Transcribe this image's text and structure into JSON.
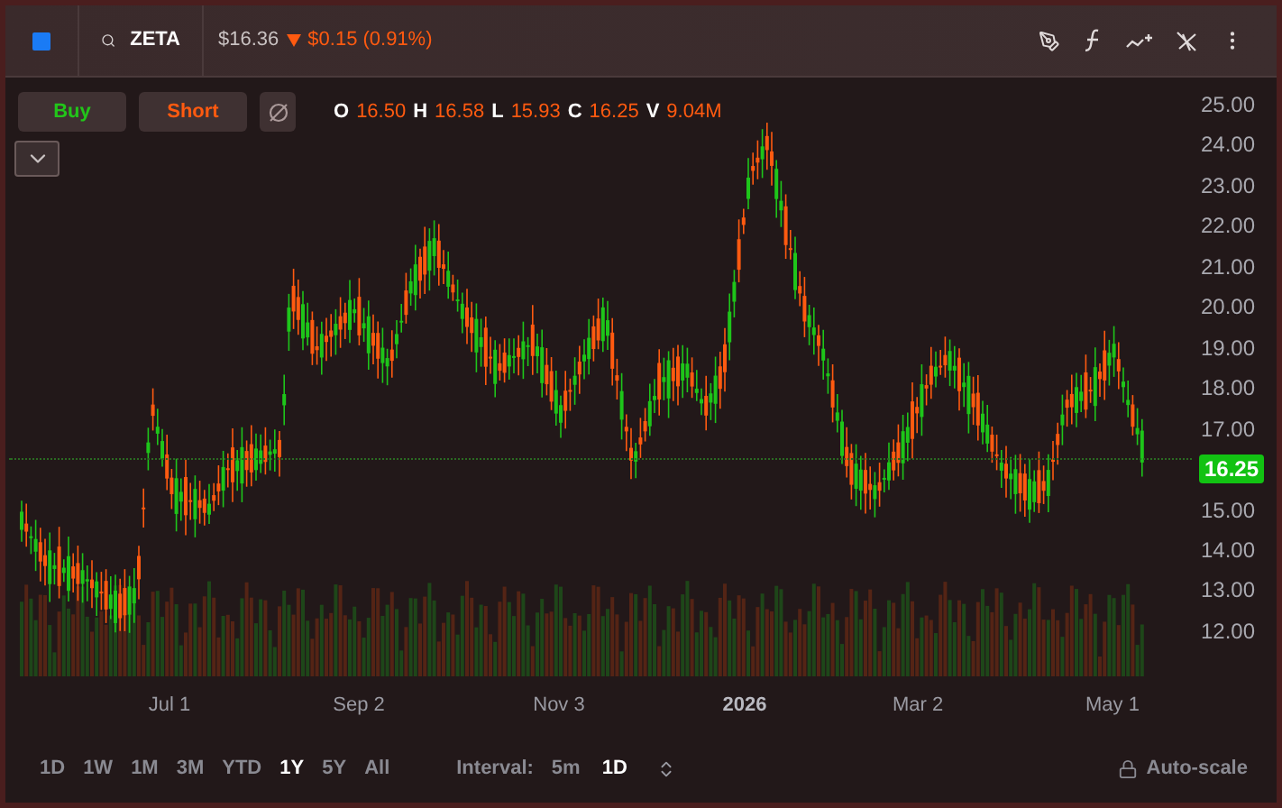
{
  "header": {
    "symbol": "ZETA",
    "price": "$16.36",
    "down": true,
    "change": "$0.15 (0.91%)"
  },
  "actions": [
    {
      "label": "Buy",
      "kind": "buy"
    },
    {
      "label": "Short",
      "kind": "short"
    }
  ],
  "ohlcv": [
    {
      "key": "O",
      "value": "16.50"
    },
    {
      "key": "H",
      "value": "16.58"
    },
    {
      "key": "L",
      "value": "15.93"
    },
    {
      "key": "C",
      "value": "16.25"
    },
    {
      "key": "V",
      "value": "9.04M"
    }
  ],
  "y_axis": [
    {
      "label": "25.00",
      "kind": "tick"
    },
    {
      "label": "24.00",
      "kind": "tick"
    },
    {
      "label": "23.00",
      "kind": "tick"
    },
    {
      "label": "22.00",
      "kind": "tick"
    },
    {
      "label": "21.00",
      "kind": "tick"
    },
    {
      "label": "20.00",
      "kind": "tick"
    },
    {
      "label": "19.00",
      "kind": "tick"
    },
    {
      "label": "18.00",
      "kind": "tick"
    },
    {
      "label": "17.00",
      "kind": "tick"
    },
    {
      "label": "16.25",
      "kind": "current"
    },
    {
      "label": "15.00",
      "kind": "tick"
    },
    {
      "label": "14.00",
      "kind": "tick"
    },
    {
      "label": "13.00",
      "kind": "tick"
    },
    {
      "label": "12.00",
      "kind": "tick"
    }
  ],
  "x_axis": [
    {
      "label": "Jul 1",
      "bold": false
    },
    {
      "label": "Sep 2",
      "bold": false
    },
    {
      "label": "Nov 3",
      "bold": false
    },
    {
      "label": "2026",
      "bold": true
    },
    {
      "label": "Mar 2",
      "bold": false
    },
    {
      "label": "May 1",
      "bold": false
    }
  ],
  "ranges": [
    {
      "label": "1D",
      "selected": false
    },
    {
      "label": "1W",
      "selected": false
    },
    {
      "label": "1M",
      "selected": false
    },
    {
      "label": "3M",
      "selected": false
    },
    {
      "label": "YTD",
      "selected": false
    },
    {
      "label": "1Y",
      "selected": true
    },
    {
      "label": "5Y",
      "selected": false
    },
    {
      "label": "All",
      "selected": false
    }
  ],
  "interval": {
    "label": "Interval:",
    "options": [
      {
        "label": "5m",
        "selected": false
      },
      {
        "label": "1D",
        "selected": true
      }
    ]
  },
  "autoscale": "Auto-scale"
}
